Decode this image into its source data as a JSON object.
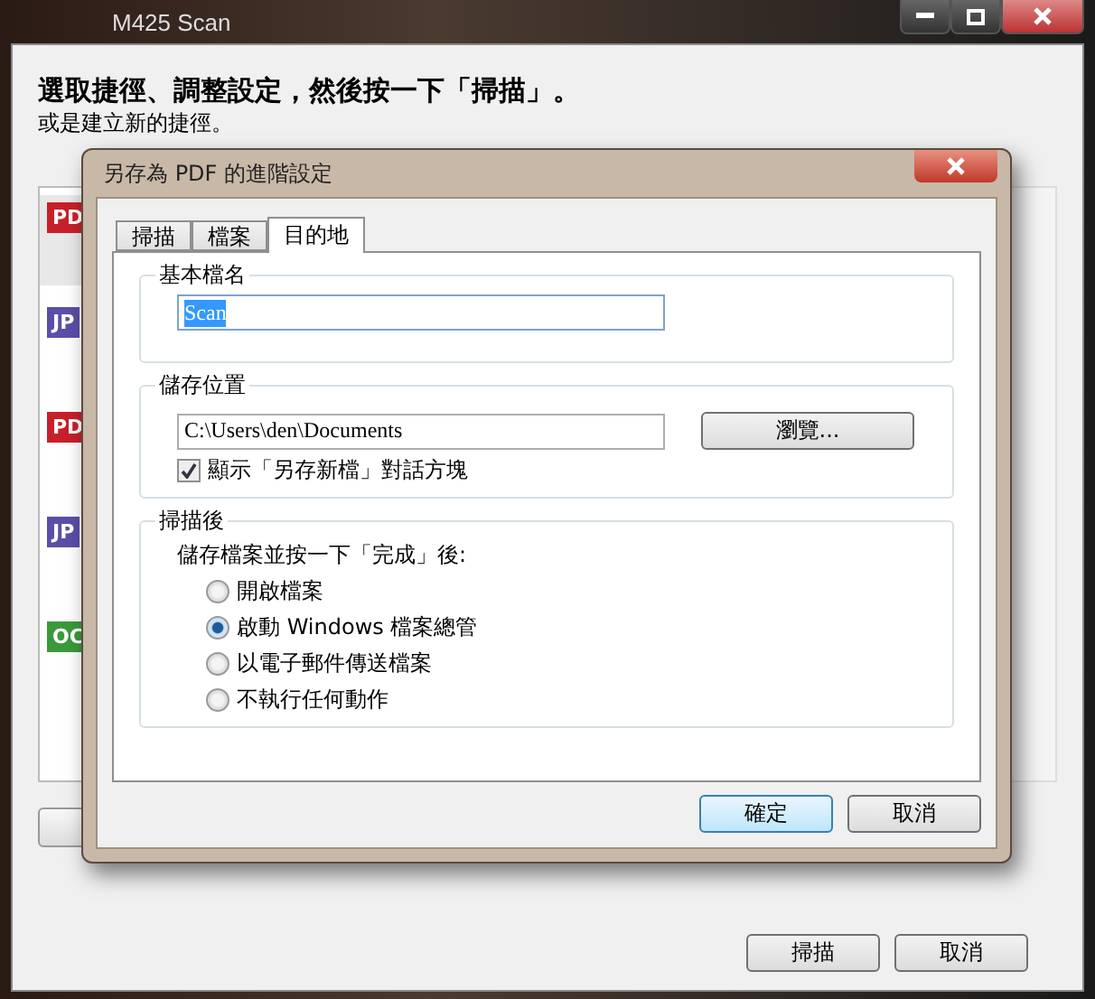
{
  "main_window": {
    "title": "M425 Scan",
    "heading": "選取捷徑、調整設定，然後按一下「掃描」。",
    "subheading": "或是建立新的捷徑。",
    "shortcuts": [
      {
        "label": "PD",
        "color": "#c8202a",
        "selected": true
      },
      {
        "label": "JP",
        "color": "#5a4fa8",
        "selected": false
      },
      {
        "label": "PD",
        "color": "#c8202a",
        "selected": false
      },
      {
        "label": "JP",
        "color": "#5a4fa8",
        "selected": false
      },
      {
        "label": "OC",
        "color": "#3a9a3a",
        "selected": false
      }
    ],
    "buttons": [
      "掃描",
      "取消"
    ]
  },
  "dialog": {
    "title": "另存為 PDF 的進階設定",
    "tabs": [
      {
        "label": "掃描",
        "selected": false
      },
      {
        "label": "檔案",
        "selected": false
      },
      {
        "label": "目的地",
        "selected": true
      }
    ],
    "base_name": {
      "legend": "基本檔名",
      "value": "Scan"
    },
    "save_location": {
      "legend": "儲存位置",
      "value": "C:\\Users\\den\\Documents",
      "browse": "瀏覽...",
      "show_dialog": {
        "label": "顯示「另存新檔」對話方塊",
        "checked": true
      }
    },
    "after_scan": {
      "legend": "掃描後",
      "prompt": "儲存檔案並按一下「完成」後:",
      "options": [
        {
          "label": "開啟檔案",
          "selected": false
        },
        {
          "label": "啟動 Windows 檔案總管",
          "selected": true
        },
        {
          "label": "以電子郵件傳送檔案",
          "selected": false
        },
        {
          "label": "不執行任何動作",
          "selected": false
        }
      ]
    },
    "buttons": [
      {
        "label": "確定",
        "default": true
      },
      {
        "label": "取消",
        "default": false
      }
    ]
  }
}
